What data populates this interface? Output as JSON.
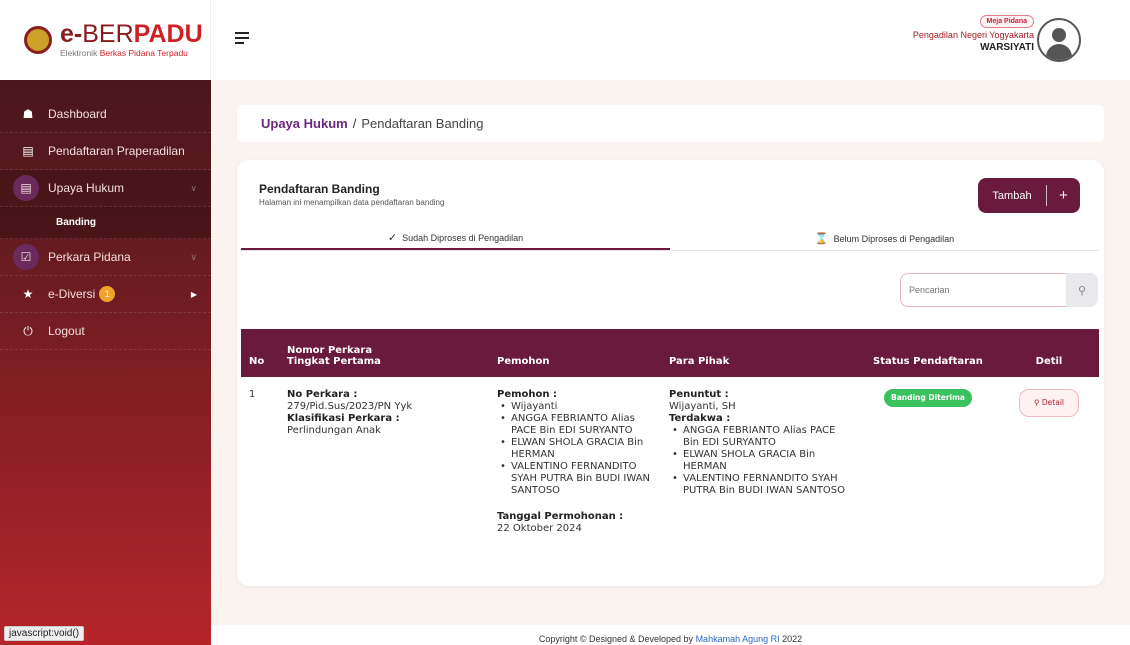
{
  "logo": {
    "title_e": "e-",
    "title_ber": "BER",
    "title_padu": "PADU",
    "sub_prefix": "Elektronik ",
    "sub_red": "Berkas Pidana Terpadu"
  },
  "sidebar": {
    "items": [
      {
        "label": "Dashboard",
        "icon": "home-icon"
      },
      {
        "label": "Pendaftaran Praperadilan",
        "icon": "document-icon"
      },
      {
        "label": "Upaya Hukum",
        "icon": "document-icon"
      },
      {
        "label": "Banding"
      },
      {
        "label": "Perkara Pidana",
        "icon": "checkbox-icon"
      },
      {
        "label": "e-Diversi",
        "badge": "1",
        "icon": "star-icon"
      },
      {
        "label": "Logout",
        "icon": "power-icon"
      }
    ]
  },
  "statusbar": {
    "url": "javascript:void()"
  },
  "header": {
    "role": "Meja Pidana",
    "court": "Pengadilan Negeri Yogyakarta",
    "user": "WARSIYATI"
  },
  "breadcrumb": {
    "parent": "Upaya Hukum",
    "separator": "/",
    "current": "Pendaftaran Banding"
  },
  "card": {
    "title": "Pendaftaran Banding",
    "subtitle": "Halaman ini menampilkan data pendaftaran banding",
    "add_button": "Tambah",
    "add_symbol": "+"
  },
  "tabs": [
    {
      "label": "Sudah Diproses di Pengadilan",
      "icon": "check-icon",
      "active": true
    },
    {
      "label": "Belum Diproses di Pengadilan",
      "icon": "hourglass-icon",
      "active": false
    }
  ],
  "search": {
    "placeholder": "Pencarian"
  },
  "table": {
    "headers": {
      "no": "No",
      "nomor_line1": "Nomor Perkara",
      "nomor_line2": "Tingkat Pertama",
      "pemohon": "Pemohon",
      "para_pihak": "Para Pihak",
      "status": "Status Pendaftaran",
      "detil": "Detil"
    },
    "rows": [
      {
        "no": "1",
        "no_perkara_label": "No Perkara :",
        "no_perkara": "279/Pid.Sus/2023/PN Yyk",
        "klasifikasi_label": "Klasifikasi Perkara :",
        "klasifikasi": "Perlindungan Anak",
        "pemohon_label": "Pemohon :",
        "pemohon": [
          "Wijayanti",
          "ANGGA FEBRIANTO Alias PACE Bin EDI SURYANTO",
          "ELWAN SHOLA GRACIA Bin HERMAN",
          "VALENTINO FERNANDITO SYAH PUTRA Bin BUDI IWAN SANTOSO"
        ],
        "tanggal_label": "Tanggal Permohonan :",
        "tanggal": "22 Oktober 2024",
        "penuntut_label": "Penuntut :",
        "penuntut": "Wijayanti, SH",
        "terdakwa_label": "Terdakwa :",
        "terdakwa": [
          "ANGGA FEBRIANTO Alias PACE Bin EDI SURYANTO",
          "ELWAN SHOLA GRACIA Bin HERMAN",
          "VALENTINO FERNANDITO SYAH PUTRA Bin BUDI IWAN SANTOSO"
        ],
        "status": "Banding Diterima",
        "detail_button": "Detail"
      }
    ]
  },
  "footer": {
    "text": "Copyright © Designed & Developed by ",
    "link": "Mahkamah Agung RI",
    "year": " 2022"
  },
  "colors": {
    "primary": "#6a1a3c",
    "sidebar_dark": "#3d1418",
    "sidebar_red": "#b5252a",
    "success": "#3ac25f"
  }
}
